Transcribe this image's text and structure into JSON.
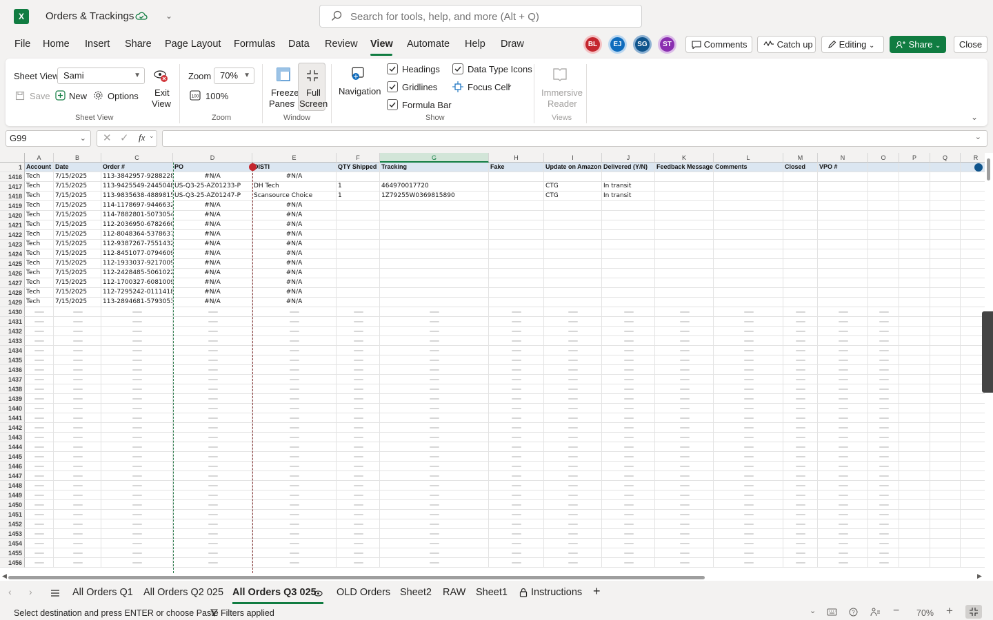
{
  "app": {
    "logo": "X",
    "title": "Orders & Trackings",
    "search_placeholder": "Search for tools, help, and more (Alt + Q)"
  },
  "menu": [
    "File",
    "Home",
    "Insert",
    "Share",
    "Page Layout",
    "Formulas",
    "Data",
    "Review",
    "View",
    "Automate",
    "Help",
    "Draw"
  ],
  "active_menu": "View",
  "collaborators": [
    {
      "initials": "BL",
      "color": "#c4262e"
    },
    {
      "initials": "EJ",
      "color": "#0f6cbd"
    },
    {
      "initials": "SG",
      "color": "#0f548c"
    },
    {
      "initials": "ST",
      "color": "#8a2fb0"
    }
  ],
  "top_buttons": {
    "comments": "Comments",
    "catchup": "Catch up",
    "editing": "Editing",
    "share": "Share",
    "close": "Close"
  },
  "ribbon": {
    "sheet_view_label": "Sheet View",
    "sheet_view_value": "Sami",
    "save": "Save",
    "new": "New",
    "options": "Options",
    "exit_view_1": "Exit",
    "exit_view_2": "View",
    "group_sheet_view": "Sheet View",
    "zoom_label": "Zoom",
    "zoom_value": "70%",
    "zoom_100": "100%",
    "group_zoom": "Zoom",
    "freeze_1": "Freeze",
    "freeze_2": "Panes",
    "full_1": "Full",
    "full_2": "Screen",
    "group_window": "Window",
    "navigation": "Navigation",
    "headings": "Headings",
    "gridlines": "Gridlines",
    "formula_bar": "Formula Bar",
    "data_type_icons": "Data Type Icons",
    "focus_cell": "Focus Cell",
    "group_show": "Show",
    "immersive_1": "Immersive",
    "immersive_2": "Reader",
    "group_views": "Views"
  },
  "formula_bar": {
    "name_box": "G99",
    "formula": ""
  },
  "columns": [
    {
      "letter": "A",
      "width": 42
    },
    {
      "letter": "B",
      "width": 69
    },
    {
      "letter": "C",
      "width": 104
    },
    {
      "letter": "D",
      "width": 115
    },
    {
      "letter": "E",
      "width": 122
    },
    {
      "letter": "F",
      "width": 63
    },
    {
      "letter": "G",
      "width": 158
    },
    {
      "letter": "H",
      "width": 80
    },
    {
      "letter": "I",
      "width": 84
    },
    {
      "letter": "J",
      "width": 77
    },
    {
      "letter": "K",
      "width": 85
    },
    {
      "letter": "L",
      "width": 101
    },
    {
      "letter": "M",
      "width": 50
    },
    {
      "letter": "N",
      "width": 73
    },
    {
      "letter": "O",
      "width": 45
    },
    {
      "letter": "P",
      "width": 45
    },
    {
      "letter": "Q",
      "width": 44
    },
    {
      "letter": "R",
      "width": 45
    }
  ],
  "selected_column": "G",
  "header_row": {
    "num": "1",
    "cells": [
      "Account",
      "Date",
      "Order #",
      "PO",
      "DISTI",
      "QTY Shipped",
      "Tracking",
      "Fake",
      "Update on Amazon",
      "Delivered (Y/N)",
      "Feedback Message",
      "Comments",
      "Closed",
      "VPO #",
      "",
      "",
      "",
      ""
    ]
  },
  "data_rows": [
    {
      "num": "1416",
      "cells": [
        "Tech",
        "7/15/2025",
        "113-3842957-9288228",
        "#N/A",
        "#N/A",
        "",
        "",
        "",
        "",
        "",
        "",
        "",
        "",
        "",
        "",
        "",
        "",
        ""
      ]
    },
    {
      "num": "1417",
      "cells": [
        "Tech",
        "7/15/2025",
        "113-9425549-2445048",
        "US-Q3-25-AZ01233-P",
        "DH Tech",
        "1",
        "464970017720",
        "",
        "CTG",
        "In transit",
        "",
        "",
        "",
        "",
        "",
        "",
        "",
        ""
      ]
    },
    {
      "num": "1418",
      "cells": [
        "Tech",
        "7/15/2025",
        "113-9835638-4889815",
        "US-Q3-25-AZ01247-P",
        "Scansource Choice",
        "1",
        "1Z79255W0369815890",
        "",
        "CTG",
        "In transit",
        "",
        "",
        "",
        "",
        "",
        "",
        "",
        ""
      ]
    },
    {
      "num": "1419",
      "cells": [
        "Tech",
        "7/15/2025",
        "114-1178697-9446632",
        "#N/A",
        "#N/A",
        "",
        "",
        "",
        "",
        "",
        "",
        "",
        "",
        "",
        "",
        "",
        "",
        ""
      ]
    },
    {
      "num": "1420",
      "cells": [
        "Tech",
        "7/15/2025",
        "114-7882801-5073054",
        "#N/A",
        "#N/A",
        "",
        "",
        "",
        "",
        "",
        "",
        "",
        "",
        "",
        "",
        "",
        "",
        ""
      ]
    },
    {
      "num": "1421",
      "cells": [
        "Tech",
        "7/15/2025",
        "112-2036950-6782660",
        "#N/A",
        "#N/A",
        "",
        "",
        "",
        "",
        "",
        "",
        "",
        "",
        "",
        "",
        "",
        "",
        ""
      ]
    },
    {
      "num": "1422",
      "cells": [
        "Tech",
        "7/15/2025",
        "112-8048364-5378637",
        "#N/A",
        "#N/A",
        "",
        "",
        "",
        "",
        "",
        "",
        "",
        "",
        "",
        "",
        "",
        "",
        ""
      ]
    },
    {
      "num": "1423",
      "cells": [
        "Tech",
        "7/15/2025",
        "112-9387267-7551432",
        "#N/A",
        "#N/A",
        "",
        "",
        "",
        "",
        "",
        "",
        "",
        "",
        "",
        "",
        "",
        "",
        ""
      ]
    },
    {
      "num": "1424",
      "cells": [
        "Tech",
        "7/15/2025",
        "112-8451077-0794609",
        "#N/A",
        "#N/A",
        "",
        "",
        "",
        "",
        "",
        "",
        "",
        "",
        "",
        "",
        "",
        "",
        ""
      ]
    },
    {
      "num": "1425",
      "cells": [
        "Tech",
        "7/15/2025",
        "112-1933037-9217009",
        "#N/A",
        "#N/A",
        "",
        "",
        "",
        "",
        "",
        "",
        "",
        "",
        "",
        "",
        "",
        "",
        ""
      ]
    },
    {
      "num": "1426",
      "cells": [
        "Tech",
        "7/15/2025",
        "112-2428485-5061022",
        "#N/A",
        "#N/A",
        "",
        "",
        "",
        "",
        "",
        "",
        "",
        "",
        "",
        "",
        "",
        "",
        ""
      ]
    },
    {
      "num": "1427",
      "cells": [
        "Tech",
        "7/15/2025",
        "112-1700327-6081009",
        "#N/A",
        "#N/A",
        "",
        "",
        "",
        "",
        "",
        "",
        "",
        "",
        "",
        "",
        "",
        "",
        ""
      ]
    },
    {
      "num": "1428",
      "cells": [
        "Tech",
        "7/15/2025",
        "112-7295242-0111418",
        "#N/A",
        "#N/A",
        "",
        "",
        "",
        "",
        "",
        "",
        "",
        "",
        "",
        "",
        "",
        "",
        ""
      ]
    },
    {
      "num": "1429",
      "cells": [
        "Tech",
        "7/15/2025",
        "113-2894681-5793053",
        "#N/A",
        "#N/A",
        "",
        "",
        "",
        "",
        "",
        "",
        "",
        "",
        "",
        "",
        "",
        "",
        ""
      ]
    }
  ],
  "empty_rows": [
    "1430",
    "1431",
    "1432",
    "1433",
    "1434",
    "1435",
    "1436",
    "1437",
    "1438",
    "1439",
    "1440",
    "1441",
    "1442",
    "1443",
    "1444",
    "1445",
    "1446",
    "1447",
    "1448",
    "1449",
    "1450",
    "1451",
    "1452",
    "1453",
    "1454",
    "1455",
    "1456"
  ],
  "sheet_tabs": [
    "All Orders Q1",
    "All Orders Q2 025",
    "All Orders Q3 025",
    "OLD Orders",
    "Sheet2",
    "RAW",
    "Sheet1",
    "Instructions"
  ],
  "active_sheet": "All Orders Q3 025",
  "status": {
    "message": "Select destination and press ENTER or choose Paste",
    "filters": "Filters applied",
    "zoom": "70%"
  },
  "colors": {
    "accent": "#107c41",
    "header_fill": "#dbe6f1"
  }
}
